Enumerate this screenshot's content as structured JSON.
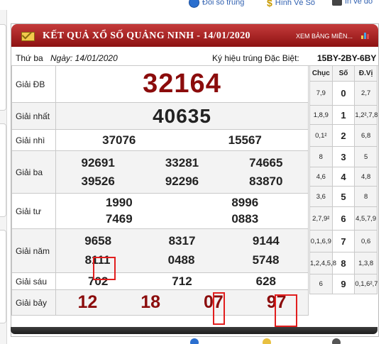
{
  "top_links": [
    {
      "label": "Đổi số trúng",
      "icon": "globe-icon"
    },
    {
      "label": "Hình Vé Số",
      "icon": "dollar-icon"
    },
    {
      "label": "In vé dò",
      "icon": "printer-icon"
    }
  ],
  "header": {
    "title": "KẾT QUẢ XỔ SỐ QUẢNG NINH - 14/01/2020",
    "view_link": "XEM BẢNG MIỀN..."
  },
  "info": {
    "weekday": "Thứ ba",
    "date": "Ngày: 14/01/2020",
    "special_code_label": "Ký hiệu trúng Đặc Biệt:",
    "special_code": "15BY-2BY-6BY"
  },
  "prizes": {
    "db": {
      "label": "Giải ĐB",
      "numbers": [
        "32164"
      ]
    },
    "g1": {
      "label": "Giải nhất",
      "numbers": [
        "40635"
      ]
    },
    "g2": {
      "label": "Giải nhì",
      "numbers": [
        "37076",
        "15567"
      ]
    },
    "g3": {
      "label": "Giải ba",
      "numbers": [
        "92691",
        "33281",
        "74665",
        "39526",
        "92296",
        "83870"
      ]
    },
    "g4": {
      "label": "Giải tư",
      "numbers": [
        "1990",
        "8996",
        "7469",
        "0883"
      ]
    },
    "g5": {
      "label": "Giải năm",
      "numbers": [
        "9658",
        "8317",
        "9144",
        "8111",
        "0488",
        "5748"
      ]
    },
    "g6": {
      "label": "Giải sáu",
      "numbers": [
        "702",
        "712",
        "628"
      ]
    },
    "g7": {
      "label": "Giải bảy",
      "numbers": [
        "12",
        "18",
        "07",
        "97"
      ]
    }
  },
  "loto": {
    "headers": [
      "Chục",
      "Số",
      "Đ.Vị"
    ],
    "rows": [
      {
        "chuc": "7,9",
        "so": "0",
        "dv": "2,7"
      },
      {
        "chuc": "1,8,9",
        "so": "1",
        "dv": "1,2²,7,8"
      },
      {
        "chuc": "0,1²",
        "so": "2",
        "dv": "6,8"
      },
      {
        "chuc": "8",
        "so": "3",
        "dv": "5"
      },
      {
        "chuc": "4,6",
        "so": "4",
        "dv": "4,8"
      },
      {
        "chuc": "3,6",
        "so": "5",
        "dv": "8"
      },
      {
        "chuc": "2,7,9²",
        "so": "6",
        "dv": "4,5,7,9"
      },
      {
        "chuc": "0,1,6,9",
        "so": "7",
        "dv": "0,6"
      },
      {
        "chuc": "1,2,4,5,8",
        "so": "8",
        "dv": "1,3,8"
      },
      {
        "chuc": "6",
        "so": "9",
        "dv": "0,1,6²,7"
      }
    ]
  },
  "colors": {
    "header_red": "#a61f1f",
    "number_red": "#8b0c0c",
    "highlight": "#e21e1e"
  }
}
